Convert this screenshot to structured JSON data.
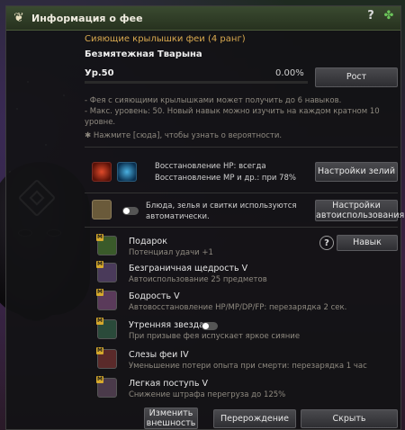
{
  "window": {
    "title": "Информация о фее"
  },
  "fairy": {
    "title": "Сияющие крылышки феи (4 ранг)",
    "name": "Безмятежная Тварына",
    "level": "Ур.50",
    "exp_percent": "0.00%",
    "grow_button": "Рост"
  },
  "notes": {
    "line1": "- Фея с сияющими крылышками может получить до 6 навыков.",
    "line2": "- Макс. уровень: 50. Новый навык можно изучить на каждом кратном 10 уровне.",
    "hint_pre": "✱ Нажмите ",
    "hint_link": "[сюда]",
    "hint_post": ", чтобы узнать о вероятности."
  },
  "potion": {
    "hp_text": "Восстановление HP: всегда",
    "mp_text": "Восстановление MP и др.: при 78%",
    "settings_button": "Настройки зелий"
  },
  "autouse": {
    "text": "Блюда, зелья и свитки используются автоматически.",
    "settings_button": "Настройки автоиспользования"
  },
  "skills": {
    "help": "?",
    "skill_button": "Навык",
    "items": [
      {
        "badge": "M",
        "title": "Подарок",
        "desc": "Потенциал удачи +1",
        "icon": "clover-icon"
      },
      {
        "badge": "M",
        "title": "Безграничная щедрость V",
        "desc": "Автоиспользование 25 предметов",
        "icon": "fairy-generosity-icon"
      },
      {
        "badge": "M",
        "title": "Бодрость V",
        "desc": "Автовосстановление HP/MP/DP/FP: перезарядка 2 сек.",
        "icon": "vigor-icon"
      },
      {
        "badge": "M",
        "title": "Утренняя звезда",
        "desc": "При призыве фея испускает яркое сияние",
        "icon": "morning-star-icon"
      },
      {
        "badge": "M",
        "title": "Слезы феи IV",
        "desc": "Уменьшение потери опыта при смерти: перезарядка 1 час",
        "icon": "fairy-tears-icon"
      },
      {
        "badge": "M",
        "title": "Легкая поступь V",
        "desc": "Снижение штрафа перегруза до 125%",
        "icon": "light-step-icon"
      }
    ]
  },
  "footer": {
    "change_look": "Изменить внешность",
    "rebirth": "Перерождение",
    "hide": "Скрыть"
  },
  "colors": {
    "accent": "#d9a94f",
    "title_bar": "#2f3b27"
  }
}
